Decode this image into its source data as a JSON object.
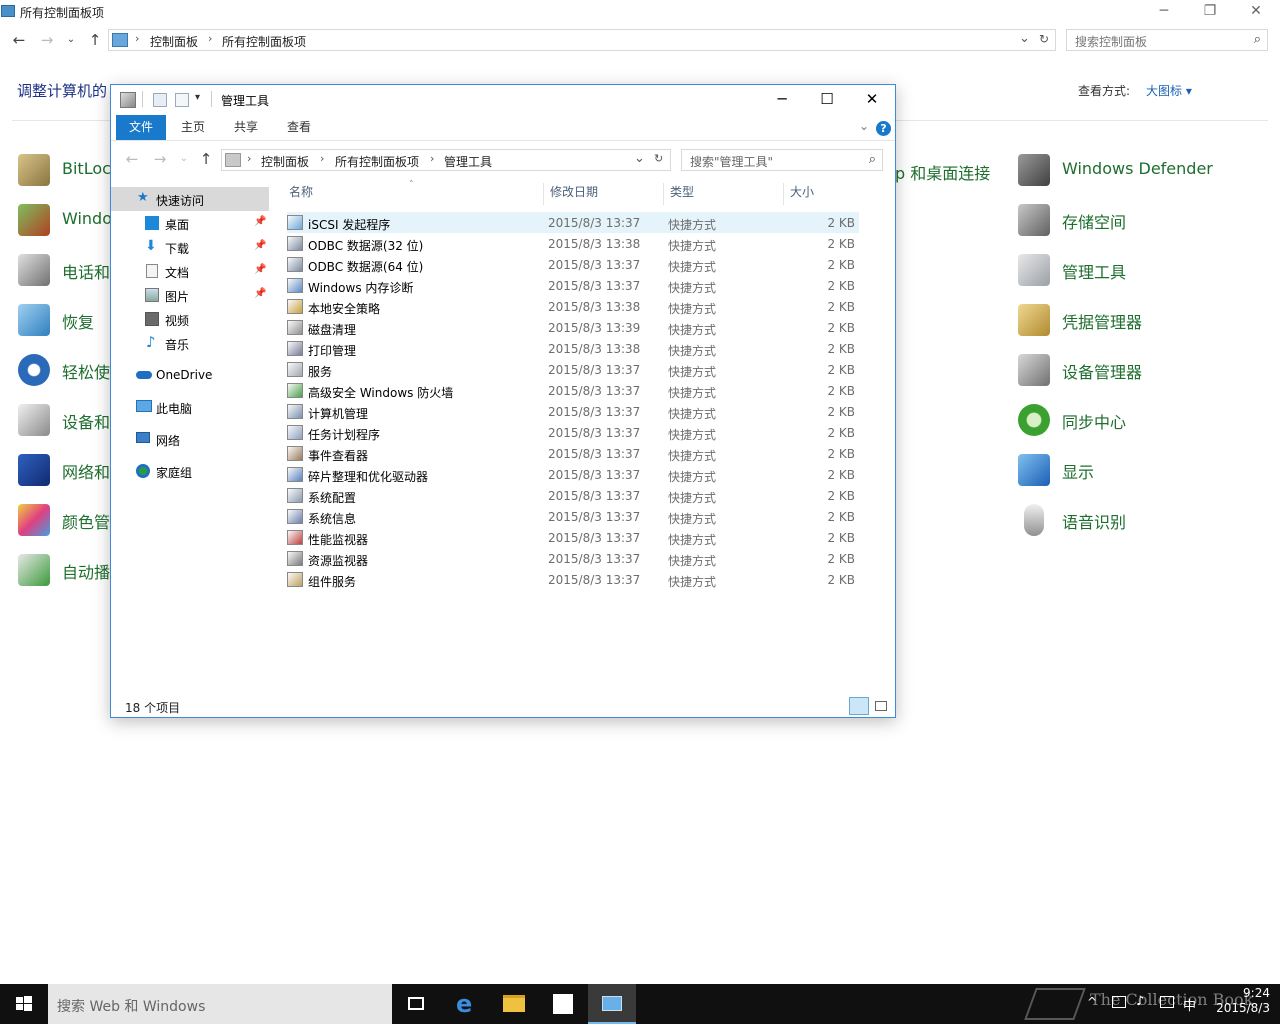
{
  "background_window": {
    "title": "所有控制面板项",
    "breadcrumb": [
      "控制面板",
      "所有控制面板项"
    ],
    "search_placeholder": "搜索控制面板",
    "heading": "调整计算机的",
    "view_label": "查看方式:",
    "view_value": "大图标 ▾",
    "partial_label": "p 和桌面连接",
    "left_items": [
      {
        "label": "BitLoc",
        "icon": "bitlocker-icon"
      },
      {
        "label": "Windo",
        "icon": "windows-firewall-icon"
      },
      {
        "label": "电话和",
        "icon": "phone-modem-icon"
      },
      {
        "label": "恢复",
        "icon": "recovery-icon"
      },
      {
        "label": "轻松使",
        "icon": "ease-of-access-icon"
      },
      {
        "label": "设备和",
        "icon": "devices-printers-icon"
      },
      {
        "label": "网络和",
        "icon": "network-center-icon"
      },
      {
        "label": "颜色管",
        "icon": "color-management-icon"
      },
      {
        "label": "自动播",
        "icon": "autoplay-icon"
      }
    ],
    "right_items": [
      {
        "label": "Windows Defender",
        "icon": "windows-defender-icon"
      },
      {
        "label": "存储空间",
        "icon": "storage-spaces-icon"
      },
      {
        "label": "管理工具",
        "icon": "admin-tools-icon"
      },
      {
        "label": "凭据管理器",
        "icon": "credential-manager-icon"
      },
      {
        "label": "设备管理器",
        "icon": "device-manager-icon"
      },
      {
        "label": "同步中心",
        "icon": "sync-center-icon"
      },
      {
        "label": "显示",
        "icon": "display-icon"
      },
      {
        "label": "语音识别",
        "icon": "speech-recognition-icon"
      }
    ]
  },
  "explorer": {
    "title": "管理工具",
    "ribbon_tabs": [
      "文件",
      "主页",
      "共享",
      "查看"
    ],
    "breadcrumb": [
      "控制面板",
      "所有控制面板项",
      "管理工具"
    ],
    "search_placeholder": "搜索\"管理工具\"",
    "nav": [
      {
        "label": "快速访问",
        "icon": "star-icon",
        "pinned": false
      },
      {
        "label": "桌面",
        "icon": "desktop-icon",
        "pinned": true
      },
      {
        "label": "下载",
        "icon": "download-icon",
        "pinned": true
      },
      {
        "label": "文档",
        "icon": "documents-icon",
        "pinned": true
      },
      {
        "label": "图片",
        "icon": "pictures-icon",
        "pinned": true
      },
      {
        "label": "视频",
        "icon": "videos-icon",
        "pinned": false
      },
      {
        "label": "音乐",
        "icon": "music-icon",
        "pinned": false
      },
      {
        "label": "OneDrive",
        "icon": "onedrive-icon",
        "pinned": false
      },
      {
        "label": "此电脑",
        "icon": "this-pc-icon",
        "pinned": false
      },
      {
        "label": "网络",
        "icon": "network-icon",
        "pinned": false
      },
      {
        "label": "家庭组",
        "icon": "homegroup-icon",
        "pinned": false
      }
    ],
    "columns": [
      "名称",
      "修改日期",
      "类型",
      "大小"
    ],
    "files": [
      {
        "name": "iSCSI 发起程序",
        "date": "2015/8/3 13:37",
        "type": "快捷方式",
        "size": "2 KB"
      },
      {
        "name": "ODBC 数据源(32 位)",
        "date": "2015/8/3 13:38",
        "type": "快捷方式",
        "size": "2 KB"
      },
      {
        "name": "ODBC 数据源(64 位)",
        "date": "2015/8/3 13:37",
        "type": "快捷方式",
        "size": "2 KB"
      },
      {
        "name": "Windows 内存诊断",
        "date": "2015/8/3 13:37",
        "type": "快捷方式",
        "size": "2 KB"
      },
      {
        "name": "本地安全策略",
        "date": "2015/8/3 13:38",
        "type": "快捷方式",
        "size": "2 KB"
      },
      {
        "name": "磁盘清理",
        "date": "2015/8/3 13:39",
        "type": "快捷方式",
        "size": "2 KB"
      },
      {
        "name": "打印管理",
        "date": "2015/8/3 13:38",
        "type": "快捷方式",
        "size": "2 KB"
      },
      {
        "name": "服务",
        "date": "2015/8/3 13:37",
        "type": "快捷方式",
        "size": "2 KB"
      },
      {
        "name": "高级安全 Windows 防火墙",
        "date": "2015/8/3 13:37",
        "type": "快捷方式",
        "size": "2 KB"
      },
      {
        "name": "计算机管理",
        "date": "2015/8/3 13:37",
        "type": "快捷方式",
        "size": "2 KB"
      },
      {
        "name": "任务计划程序",
        "date": "2015/8/3 13:37",
        "type": "快捷方式",
        "size": "2 KB"
      },
      {
        "name": "事件查看器",
        "date": "2015/8/3 13:37",
        "type": "快捷方式",
        "size": "2 KB"
      },
      {
        "name": "碎片整理和优化驱动器",
        "date": "2015/8/3 13:37",
        "type": "快捷方式",
        "size": "2 KB"
      },
      {
        "name": "系统配置",
        "date": "2015/8/3 13:37",
        "type": "快捷方式",
        "size": "2 KB"
      },
      {
        "name": "系统信息",
        "date": "2015/8/3 13:37",
        "type": "快捷方式",
        "size": "2 KB"
      },
      {
        "name": "性能监视器",
        "date": "2015/8/3 13:37",
        "type": "快捷方式",
        "size": "2 KB"
      },
      {
        "name": "资源监视器",
        "date": "2015/8/3 13:37",
        "type": "快捷方式",
        "size": "2 KB"
      },
      {
        "name": "组件服务",
        "date": "2015/8/3 13:37",
        "type": "快捷方式",
        "size": "2 KB"
      }
    ],
    "status": "18 个项目"
  },
  "taskbar": {
    "search_placeholder": "搜索 Web 和 Windows",
    "time": "9:24",
    "date": "2015/8/3",
    "ime": "中",
    "watermark": "The Collection Book"
  },
  "colors": {
    "accent": "#1979ca",
    "link_green": "#1e6e2e",
    "heading_blue": "#1e3287",
    "selection": "#e5f3fb",
    "taskbar": "#101010"
  }
}
